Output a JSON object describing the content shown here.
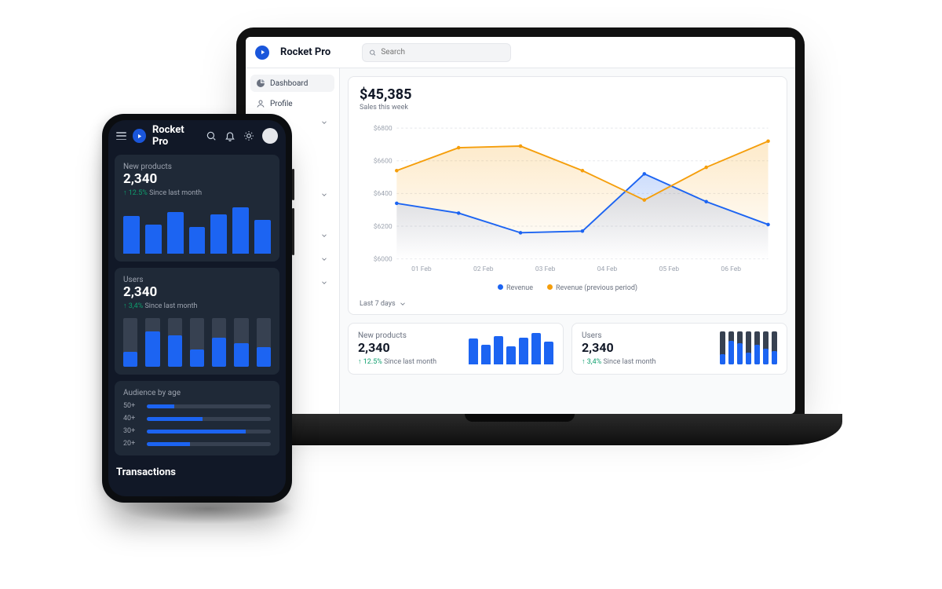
{
  "brand": "Rocket Pro",
  "search": {
    "placeholder": "Search"
  },
  "colors": {
    "primary": "#1c64f2",
    "secondary": "#f59e0b",
    "track": "#374151",
    "green": "#0e9f6e"
  },
  "sidebar": {
    "items": [
      {
        "label": "Dashboard"
      },
      {
        "label": "Profile"
      }
    ]
  },
  "sales_card": {
    "value": "$45,385",
    "caption": "Sales this week",
    "range_label": "Last 7 days",
    "legend_revenue": "Revenue",
    "legend_prev": "Revenue (previous period)"
  },
  "chart_data": {
    "type": "line",
    "title": "Sales this week",
    "xlabel": "",
    "ylabel": "",
    "categories": [
      "01 Feb",
      "02 Feb",
      "03 Feb",
      "04 Feb",
      "05 Feb",
      "06 Feb"
    ],
    "yticks": [
      "$6000",
      "$6200",
      "$6400",
      "$6600",
      "$6800"
    ],
    "ylim": [
      6000,
      6800
    ],
    "series": [
      {
        "name": "Revenue",
        "color": "#1c64f2",
        "values": [
          6340,
          6280,
          6160,
          6170,
          6520,
          6350,
          6210
        ]
      },
      {
        "name": "Revenue (previous period)",
        "color": "#f59e0b",
        "values": [
          6540,
          6680,
          6690,
          6540,
          6360,
          6560,
          6720
        ]
      }
    ]
  },
  "new_products": {
    "title": "New products",
    "value": "2,340",
    "trend_pct": "12.5%",
    "trend_caption": "Since last month",
    "bars_pct": [
      78,
      60,
      85,
      55,
      80,
      95,
      70
    ]
  },
  "users": {
    "title": "Users",
    "value": "2,340",
    "trend_pct": "3,4%",
    "trend_caption": "Since last month",
    "bars_pct": [
      30,
      72,
      65,
      35,
      60,
      48,
      40
    ]
  },
  "phone_new_products": {
    "title": "New products",
    "value": "2,340",
    "trend_pct": "12.5%",
    "trend_caption": "Since last month",
    "bars_pct": [
      78,
      60,
      85,
      55,
      80,
      95,
      70
    ]
  },
  "phone_users": {
    "title": "Users",
    "value": "2,340",
    "trend_pct": "3,4%",
    "trend_caption": "Since last month",
    "bars_pct": [
      30,
      72,
      65,
      35,
      60,
      48,
      40
    ]
  },
  "audience": {
    "title": "Audience by age",
    "rows": [
      {
        "label": "50+",
        "pct": 22
      },
      {
        "label": "40+",
        "pct": 45
      },
      {
        "label": "30+",
        "pct": 80
      },
      {
        "label": "20+",
        "pct": 35
      }
    ]
  },
  "transactions": {
    "title": "Transactions"
  }
}
